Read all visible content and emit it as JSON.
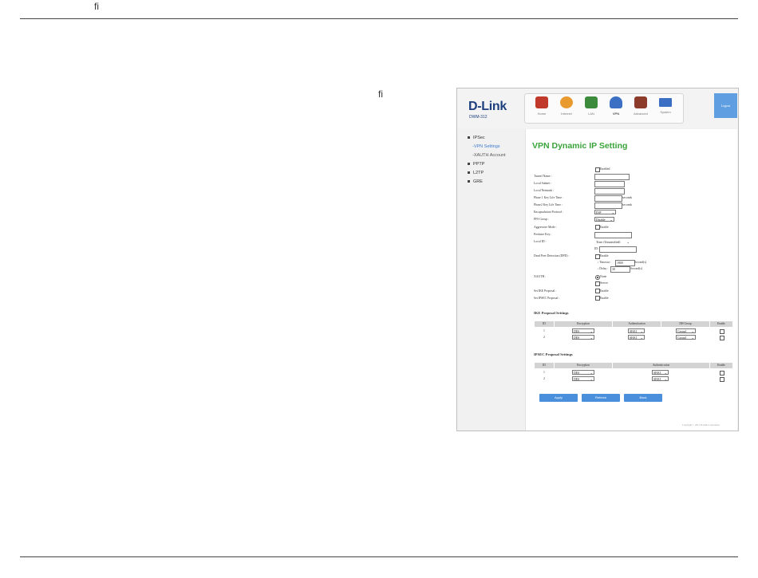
{
  "page": {
    "fi_top": "ﬁ",
    "fi_mid": "ﬁ"
  },
  "router": {
    "brand": "D-Link",
    "model": "DWM-312",
    "corner_button": "Logout",
    "nav": [
      {
        "label": "Home",
        "icon": "home-icon",
        "color": "#c0392b"
      },
      {
        "label": "Internet",
        "icon": "globe-icon",
        "color": "#e89a2f"
      },
      {
        "label": "LAN",
        "icon": "lan-icon",
        "color": "#3c8a3c"
      },
      {
        "label": "VPN",
        "icon": "vpn-icon",
        "color": "#3b6fc4"
      },
      {
        "label": "Advanced",
        "icon": "advanced-icon",
        "color": "#8c3a2a"
      },
      {
        "label": "System",
        "icon": "system-icon",
        "color": "#3b6fc4"
      }
    ],
    "active_nav": "VPN"
  },
  "sidebar": {
    "items": [
      {
        "label": "IPSec"
      },
      {
        "label": "-VPN Settings"
      },
      {
        "label": "-XAUTH Account"
      },
      {
        "label": "PPTP"
      },
      {
        "label": "L2TP"
      },
      {
        "label": "GRE"
      }
    ]
  },
  "form": {
    "title": "VPN Dynamic IP Setting",
    "enabled_label": "Enabled",
    "labels": {
      "tunnel_name": "Tunnel Name :",
      "local_subnet": "Local Subnet :",
      "local_netmask": "Local Netmask :",
      "phase1": "Phase 1 Key Life Time :",
      "phase2": "Phase2 Key Life Time :",
      "encap": "Encapsulation Protocol :",
      "pfs": "PFS Group :",
      "aggressive": "Aggressive Mode :",
      "psk": "Preshare Key :",
      "local_id": "Local ID :",
      "dpd": "Dead Peer Detection (DPD) :",
      "xauth": "XAUTH :",
      "ike_prop": "Set IKE Proposal :",
      "ipsec_prop": "Set IPSEC Proposal :"
    },
    "seconds": "seconds",
    "encap_value": "ESP",
    "pfs_value": "Disable",
    "enable_label": "Enable",
    "local_id_type": "Type: (Unspecified)",
    "id_label": "ID:",
    "timeout_label": "Timeout :",
    "timeout_value": "1800",
    "delay_label": "Delay :",
    "delay_value": "30",
    "seconds_cap": "Second(s)",
    "xauth_none": "None",
    "xauth_server": "Server"
  },
  "ike": {
    "title": "IKE Proposal Settings",
    "headers": [
      "ID",
      "Encryption",
      "Authentication",
      "DH Group",
      "Enable"
    ],
    "rows": [
      {
        "id": "1",
        "enc": "DES",
        "auth": "SHA1",
        "dh": "Group1"
      },
      {
        "id": "2",
        "enc": "DES",
        "auth": "SHA1",
        "dh": "Group1"
      }
    ]
  },
  "ipsec": {
    "title": "IPSEC Proposal Settings",
    "headers": [
      "ID",
      "Encryption",
      "Authentication",
      "Enable"
    ],
    "rows": [
      {
        "id": "1",
        "enc": "DES",
        "auth": "SHA1"
      },
      {
        "id": "2",
        "enc": "DES",
        "auth": "SHA1"
      }
    ]
  },
  "buttons": {
    "apply": "Apply",
    "refresh": "Refresh",
    "back": "Back"
  },
  "copyright": "Copyright © 2012 D-Link Corporation"
}
